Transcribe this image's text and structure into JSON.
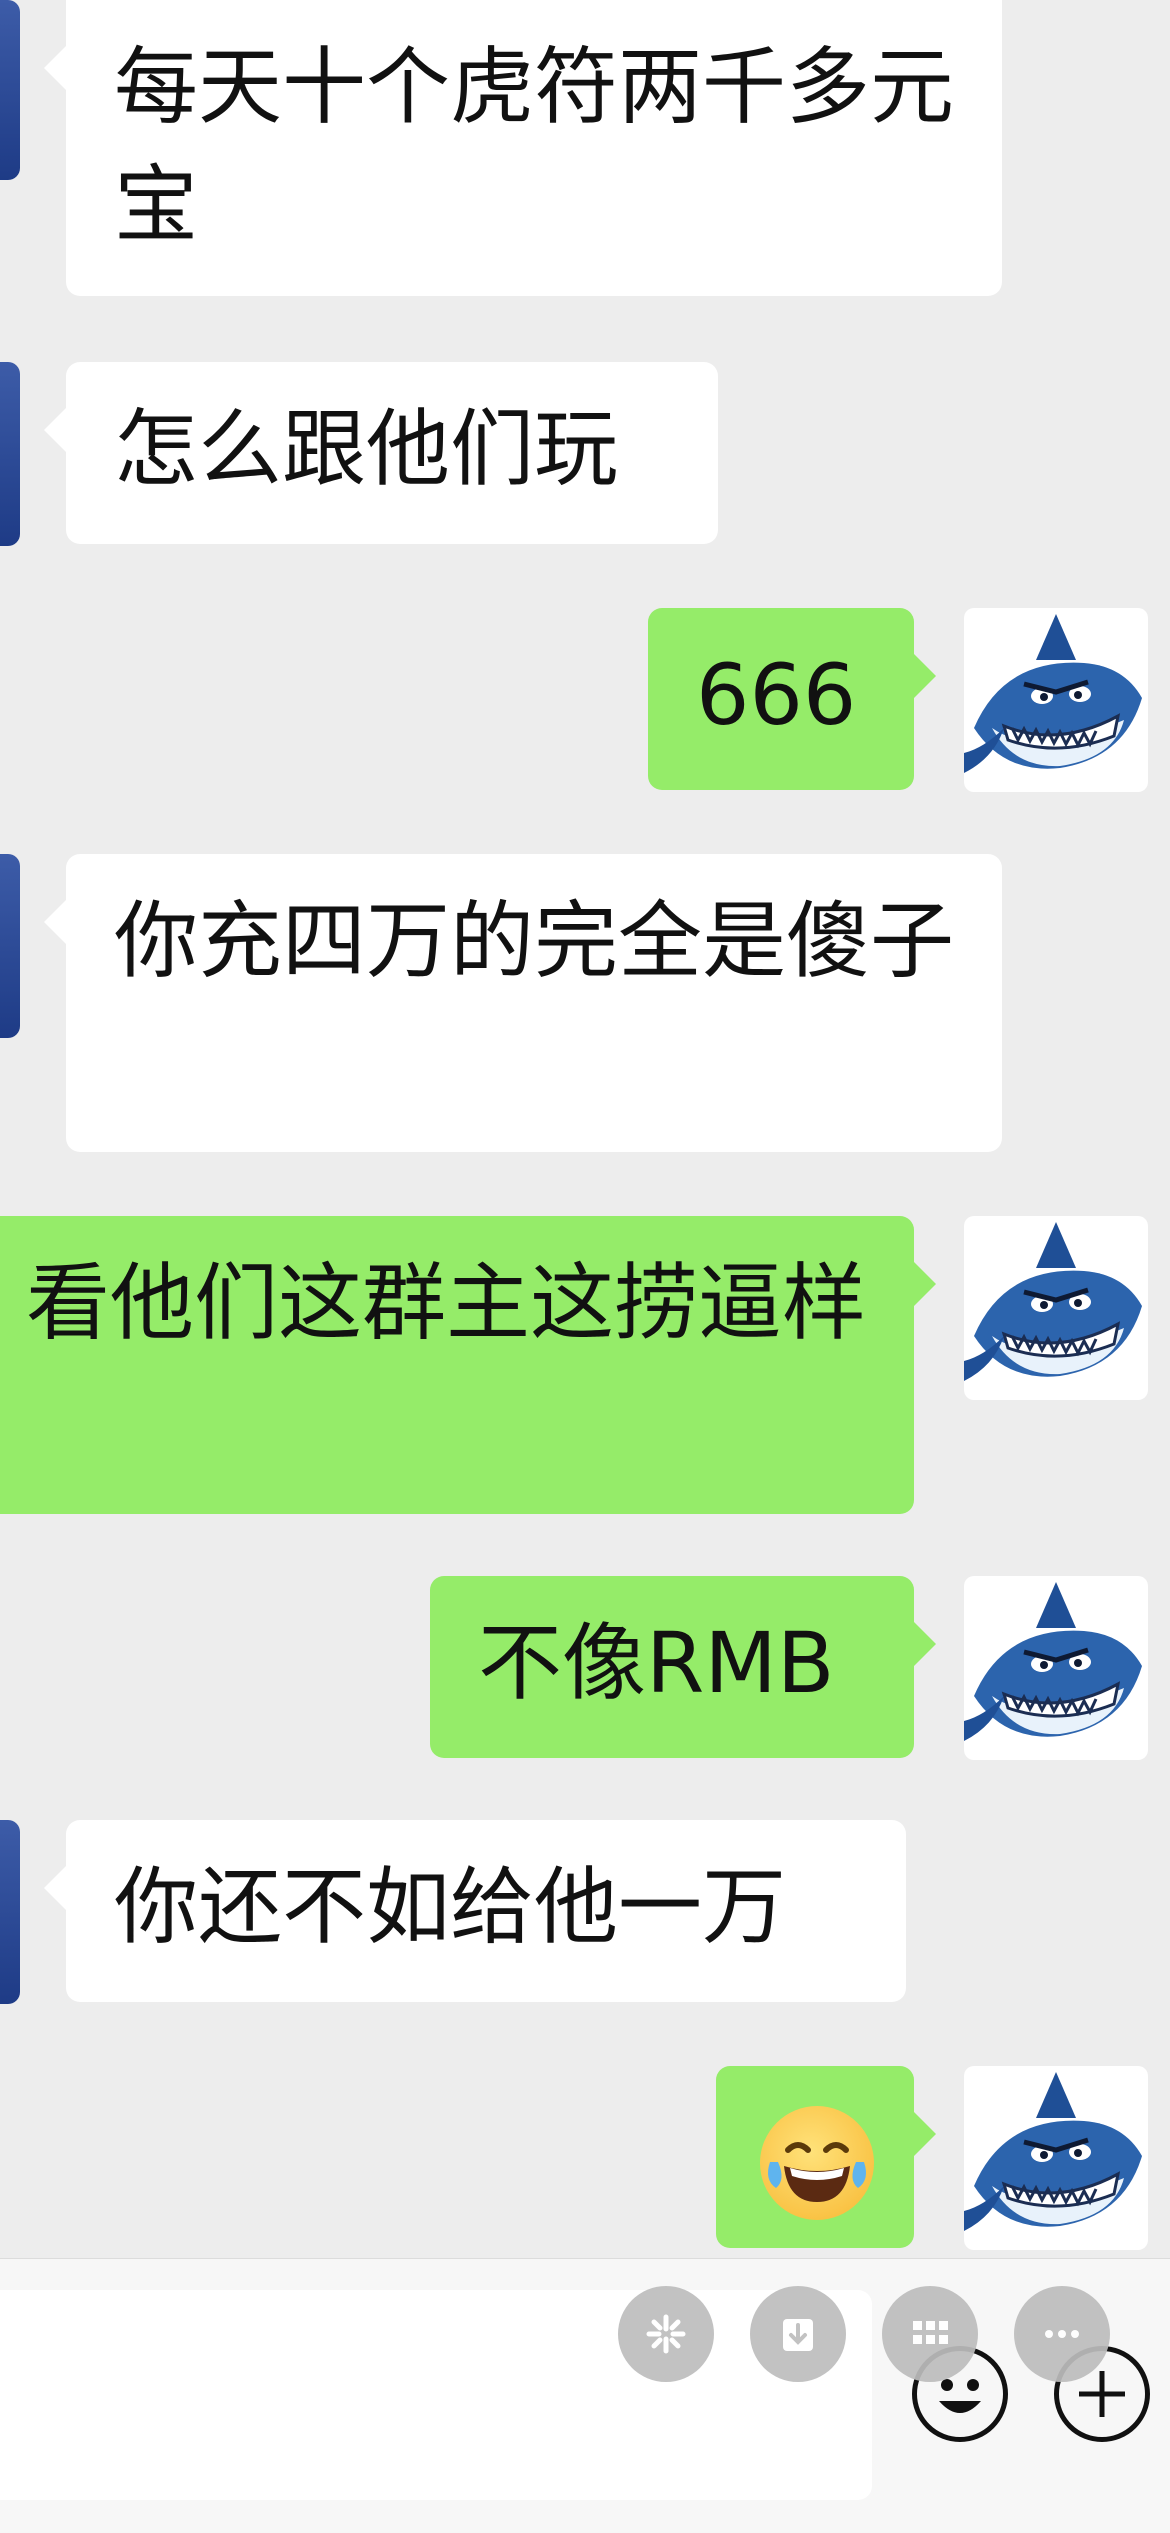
{
  "messages": [
    {
      "side": "in",
      "text": "每天十个虎符两千多元宝"
    },
    {
      "side": "in",
      "text": "怎么跟他们玩"
    },
    {
      "side": "out",
      "text": "666"
    },
    {
      "side": "in",
      "text": "你充四万的完全是傻子"
    },
    {
      "side": "out",
      "text": "看他们这群主这捞逼样"
    },
    {
      "side": "out",
      "text": "不像RMB"
    },
    {
      "side": "in",
      "text": "你还不如给他一万"
    },
    {
      "side": "out",
      "emoji": "face-with-tears-of-joy"
    }
  ],
  "icons": {
    "avatar_self": "shark-avatar-icon",
    "avatar_other": "blue-avatar-icon",
    "emoji": "face-with-tears-of-joy-icon",
    "floating": [
      "sparkle-icon",
      "download-icon",
      "grid-icon",
      "more-icon"
    ],
    "bottom": [
      "smiley-icon",
      "plus-icon"
    ]
  },
  "colors": {
    "background": "#ededed",
    "bubble_in": "#ffffff",
    "bubble_out": "#95ec69"
  }
}
